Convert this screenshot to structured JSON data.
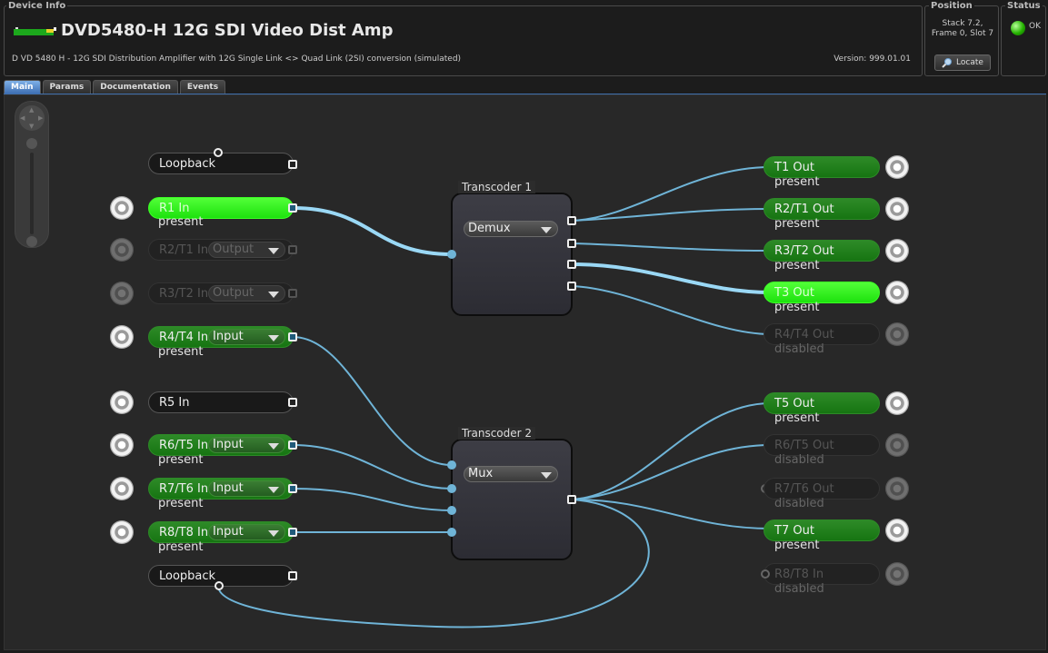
{
  "header": {
    "device_info_legend": "Device Info",
    "device_title": "DVD5480-H 12G SDI Video Dist Amp",
    "description": "D VD 5480 H - 12G SDI Distribution Amplifier with 12G Single Link <> Quad Link (2SI) conversion (simulated)",
    "version": "Version: 999.01.01",
    "position_legend": "Position",
    "position_line1": "Stack 7.2,",
    "position_line2": "Frame 0, Slot 7",
    "locate_label": "Locate",
    "status_legend": "Status",
    "status_text": "OK"
  },
  "tabs": [
    {
      "label": "Main",
      "active": true
    },
    {
      "label": "Params"
    },
    {
      "label": "Documentation"
    },
    {
      "label": "Events"
    }
  ],
  "inputs": {
    "loopback_top": "Loopback",
    "r1": {
      "label": "R1 In",
      "status": "present"
    },
    "r2": {
      "label": "R2/T1 In",
      "mode": "Output"
    },
    "r3": {
      "label": "R3/T2 In",
      "mode": "Output"
    },
    "r4": {
      "label": "R4/T4 In",
      "mode": "Input",
      "status": "present"
    },
    "r5": {
      "label": "R5 In"
    },
    "r6": {
      "label": "R6/T5 In",
      "mode": "Input",
      "status": "present"
    },
    "r7": {
      "label": "R7/T6 In",
      "mode": "Input",
      "status": "present"
    },
    "r8": {
      "label": "R8/T8 In",
      "mode": "Input",
      "status": "present"
    },
    "loopback_bottom": "Loopback"
  },
  "transcoders": [
    {
      "title": "Transcoder 1",
      "mode": "Demux"
    },
    {
      "title": "Transcoder 2",
      "mode": "Mux"
    }
  ],
  "outputs": {
    "t1": {
      "label": "T1 Out",
      "status": "present"
    },
    "r2t1": {
      "label": "R2/T1 Out",
      "status": "present"
    },
    "r3t2": {
      "label": "R3/T2 Out",
      "status": "present"
    },
    "t3": {
      "label": "T3 Out",
      "status": "present"
    },
    "r4t4": {
      "label": "R4/T4 Out",
      "status": "disabled"
    },
    "t5": {
      "label": "T5 Out",
      "status": "present"
    },
    "r6t5": {
      "label": "R6/T5 Out",
      "status": "disabled"
    },
    "r7t6": {
      "label": "R7/T6 Out",
      "status": "disabled"
    },
    "t7": {
      "label": "T7 Out",
      "status": "present"
    },
    "r8t8": {
      "label": "R8/T8 In",
      "status": "disabled"
    }
  },
  "colors": {
    "wire": "#6fb4d7",
    "active_node": "#1de20e",
    "present_node": "#1f7a18",
    "tab_active": "#3e6fb3"
  }
}
